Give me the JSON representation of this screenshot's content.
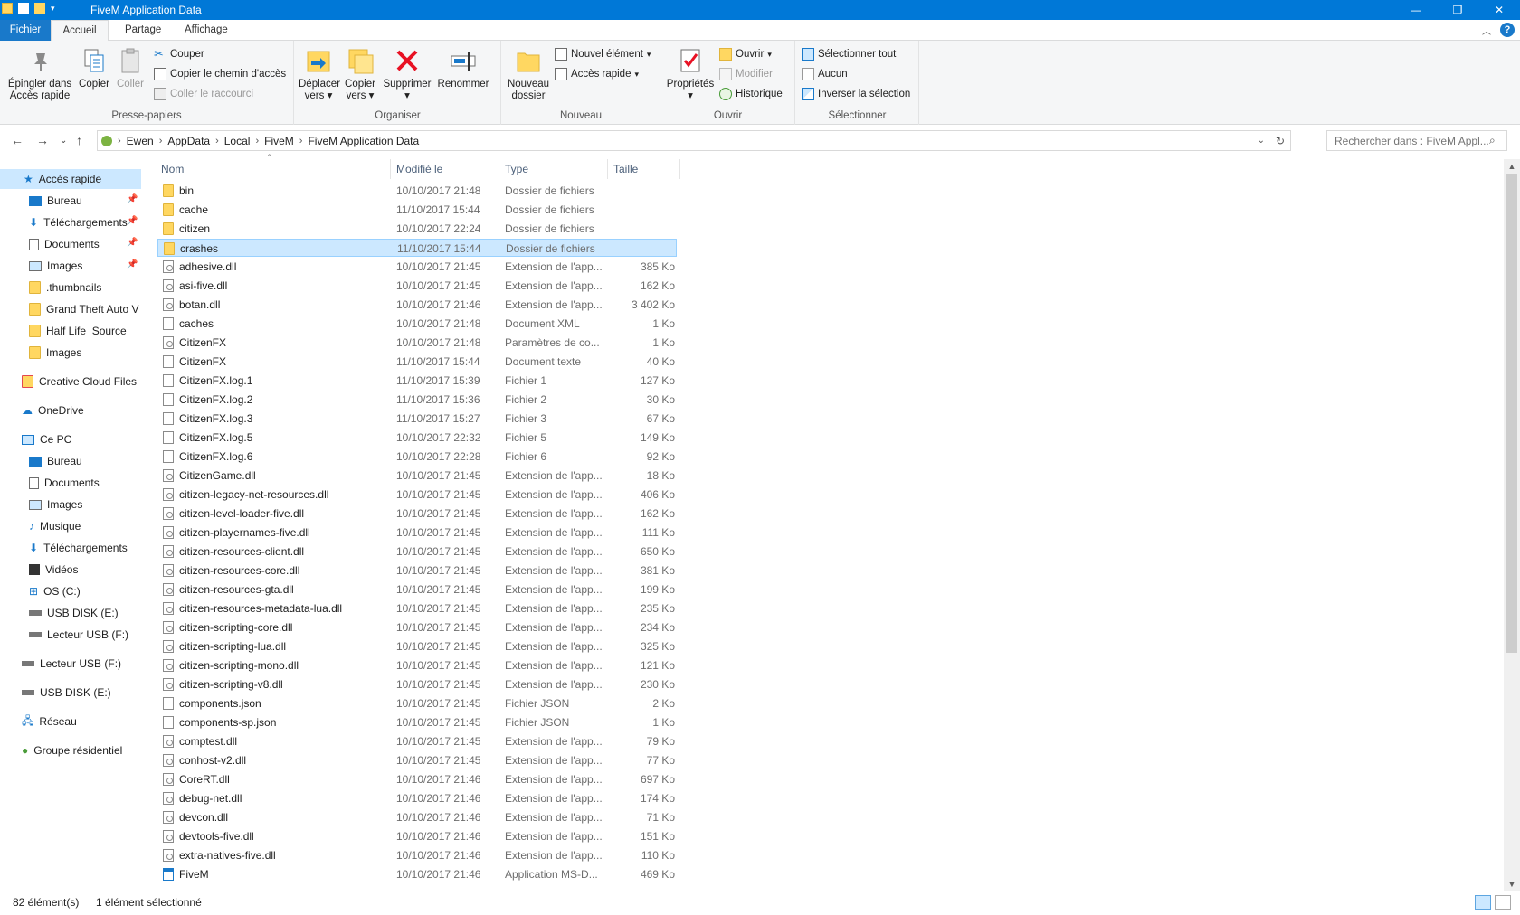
{
  "window": {
    "title": "FiveM Application Data",
    "controls": [
      "minimize",
      "restore",
      "close"
    ]
  },
  "tabs": {
    "file": "Fichier",
    "home": "Accueil",
    "share": "Partage",
    "view": "Affichage"
  },
  "ribbon": {
    "clipboard": {
      "label": "Presse-papiers",
      "pin_line1": "Épingler dans",
      "pin_line2": "Accès rapide",
      "copy": "Copier",
      "paste": "Coller",
      "cut": "Couper",
      "copy_path": "Copier le chemin d'accès",
      "paste_shortcut": "Coller le raccourci"
    },
    "organize": {
      "label": "Organiser",
      "move_line1": "Déplacer",
      "move_line2": "vers",
      "copyto_line1": "Copier",
      "copyto_line2": "vers",
      "delete": "Supprimer",
      "rename": "Renommer"
    },
    "new": {
      "label": "Nouveau",
      "new_folder_line1": "Nouveau",
      "new_folder_line2": "dossier",
      "new_item": "Nouvel élément",
      "easy_access": "Accès rapide"
    },
    "open": {
      "label": "Ouvrir",
      "properties": "Propriétés",
      "open": "Ouvrir",
      "edit": "Modifier",
      "history": "Historique"
    },
    "select": {
      "label": "Sélectionner",
      "select_all": "Sélectionner tout",
      "select_none": "Aucun",
      "invert": "Inverser la sélection"
    }
  },
  "address": {
    "crumbs": [
      "Ewen",
      "AppData",
      "Local",
      "FiveM",
      "FiveM Application Data"
    ],
    "search_placeholder": "Rechercher dans : FiveM Appl..."
  },
  "navpane": {
    "quick_access": "Accès rapide",
    "quick_items": [
      "Bureau",
      "Téléchargements",
      "Documents",
      "Images",
      ".thumbnails",
      "Grand Theft Auto V",
      "Half Life  Source",
      "Images"
    ],
    "creative_cloud": "Creative Cloud Files",
    "onedrive": "OneDrive",
    "this_pc": "Ce PC",
    "pc_items": [
      "Bureau",
      "Documents",
      "Images",
      "Musique",
      "Téléchargements",
      "Vidéos",
      "OS (C:)",
      "USB DISK (E:)",
      "Lecteur USB (F:)"
    ],
    "usb_f": "Lecteur USB (F:)",
    "usb_e": "USB DISK (E:)",
    "network": "Réseau",
    "homegroup": "Groupe résidentiel"
  },
  "columns": {
    "name": "Nom",
    "modified": "Modifié le",
    "type": "Type",
    "size": "Taille"
  },
  "files": [
    {
      "name": "bin",
      "date": "10/10/2017 21:48",
      "type": "Dossier de fichiers",
      "size": "",
      "icon": "folder"
    },
    {
      "name": "cache",
      "date": "11/10/2017 15:44",
      "type": "Dossier de fichiers",
      "size": "",
      "icon": "folder"
    },
    {
      "name": "citizen",
      "date": "10/10/2017 22:24",
      "type": "Dossier de fichiers",
      "size": "",
      "icon": "folder"
    },
    {
      "name": "crashes",
      "date": "11/10/2017 15:44",
      "type": "Dossier de fichiers",
      "size": "",
      "icon": "folder",
      "selected": true
    },
    {
      "name": "adhesive.dll",
      "date": "10/10/2017 21:45",
      "type": "Extension de l'app...",
      "size": "385 Ko",
      "icon": "dll"
    },
    {
      "name": "asi-five.dll",
      "date": "10/10/2017 21:45",
      "type": "Extension de l'app...",
      "size": "162 Ko",
      "icon": "dll"
    },
    {
      "name": "botan.dll",
      "date": "10/10/2017 21:46",
      "type": "Extension de l'app...",
      "size": "3 402 Ko",
      "icon": "dll"
    },
    {
      "name": "caches",
      "date": "10/10/2017 21:48",
      "type": "Document XML",
      "size": "1 Ko",
      "icon": "doc"
    },
    {
      "name": "CitizenFX",
      "date": "10/10/2017 21:48",
      "type": "Paramètres de co...",
      "size": "1 Ko",
      "icon": "dll"
    },
    {
      "name": "CitizenFX",
      "date": "11/10/2017 15:44",
      "type": "Document texte",
      "size": "40 Ko",
      "icon": "doc"
    },
    {
      "name": "CitizenFX.log.1",
      "date": "11/10/2017 15:39",
      "type": "Fichier 1",
      "size": "127 Ko",
      "icon": "doc"
    },
    {
      "name": "CitizenFX.log.2",
      "date": "11/10/2017 15:36",
      "type": "Fichier 2",
      "size": "30 Ko",
      "icon": "doc"
    },
    {
      "name": "CitizenFX.log.3",
      "date": "11/10/2017 15:27",
      "type": "Fichier 3",
      "size": "67 Ko",
      "icon": "doc"
    },
    {
      "name": "CitizenFX.log.5",
      "date": "10/10/2017 22:32",
      "type": "Fichier 5",
      "size": "149 Ko",
      "icon": "doc"
    },
    {
      "name": "CitizenFX.log.6",
      "date": "10/10/2017 22:28",
      "type": "Fichier 6",
      "size": "92 Ko",
      "icon": "doc"
    },
    {
      "name": "CitizenGame.dll",
      "date": "10/10/2017 21:45",
      "type": "Extension de l'app...",
      "size": "18 Ko",
      "icon": "dll"
    },
    {
      "name": "citizen-legacy-net-resources.dll",
      "date": "10/10/2017 21:45",
      "type": "Extension de l'app...",
      "size": "406 Ko",
      "icon": "dll"
    },
    {
      "name": "citizen-level-loader-five.dll",
      "date": "10/10/2017 21:45",
      "type": "Extension de l'app...",
      "size": "162 Ko",
      "icon": "dll"
    },
    {
      "name": "citizen-playernames-five.dll",
      "date": "10/10/2017 21:45",
      "type": "Extension de l'app...",
      "size": "111 Ko",
      "icon": "dll"
    },
    {
      "name": "citizen-resources-client.dll",
      "date": "10/10/2017 21:45",
      "type": "Extension de l'app...",
      "size": "650 Ko",
      "icon": "dll"
    },
    {
      "name": "citizen-resources-core.dll",
      "date": "10/10/2017 21:45",
      "type": "Extension de l'app...",
      "size": "381 Ko",
      "icon": "dll"
    },
    {
      "name": "citizen-resources-gta.dll",
      "date": "10/10/2017 21:45",
      "type": "Extension de l'app...",
      "size": "199 Ko",
      "icon": "dll"
    },
    {
      "name": "citizen-resources-metadata-lua.dll",
      "date": "10/10/2017 21:45",
      "type": "Extension de l'app...",
      "size": "235 Ko",
      "icon": "dll"
    },
    {
      "name": "citizen-scripting-core.dll",
      "date": "10/10/2017 21:45",
      "type": "Extension de l'app...",
      "size": "234 Ko",
      "icon": "dll"
    },
    {
      "name": "citizen-scripting-lua.dll",
      "date": "10/10/2017 21:45",
      "type": "Extension de l'app...",
      "size": "325 Ko",
      "icon": "dll"
    },
    {
      "name": "citizen-scripting-mono.dll",
      "date": "10/10/2017 21:45",
      "type": "Extension de l'app...",
      "size": "121 Ko",
      "icon": "dll"
    },
    {
      "name": "citizen-scripting-v8.dll",
      "date": "10/10/2017 21:45",
      "type": "Extension de l'app...",
      "size": "230 Ko",
      "icon": "dll"
    },
    {
      "name": "components.json",
      "date": "10/10/2017 21:45",
      "type": "Fichier JSON",
      "size": "2 Ko",
      "icon": "doc"
    },
    {
      "name": "components-sp.json",
      "date": "10/10/2017 21:45",
      "type": "Fichier JSON",
      "size": "1 Ko",
      "icon": "doc"
    },
    {
      "name": "comptest.dll",
      "date": "10/10/2017 21:45",
      "type": "Extension de l'app...",
      "size": "79 Ko",
      "icon": "dll"
    },
    {
      "name": "conhost-v2.dll",
      "date": "10/10/2017 21:45",
      "type": "Extension de l'app...",
      "size": "77 Ko",
      "icon": "dll"
    },
    {
      "name": "CoreRT.dll",
      "date": "10/10/2017 21:46",
      "type": "Extension de l'app...",
      "size": "697 Ko",
      "icon": "dll"
    },
    {
      "name": "debug-net.dll",
      "date": "10/10/2017 21:46",
      "type": "Extension de l'app...",
      "size": "174 Ko",
      "icon": "dll"
    },
    {
      "name": "devcon.dll",
      "date": "10/10/2017 21:46",
      "type": "Extension de l'app...",
      "size": "71 Ko",
      "icon": "dll"
    },
    {
      "name": "devtools-five.dll",
      "date": "10/10/2017 21:46",
      "type": "Extension de l'app...",
      "size": "151 Ko",
      "icon": "dll"
    },
    {
      "name": "extra-natives-five.dll",
      "date": "10/10/2017 21:46",
      "type": "Extension de l'app...",
      "size": "110 Ko",
      "icon": "dll"
    },
    {
      "name": "FiveM",
      "date": "10/10/2017 21:46",
      "type": "Application MS-D...",
      "size": "469 Ko",
      "icon": "exe"
    }
  ],
  "status": {
    "count": "82 élément(s)",
    "selection": "1 élément sélectionné"
  }
}
